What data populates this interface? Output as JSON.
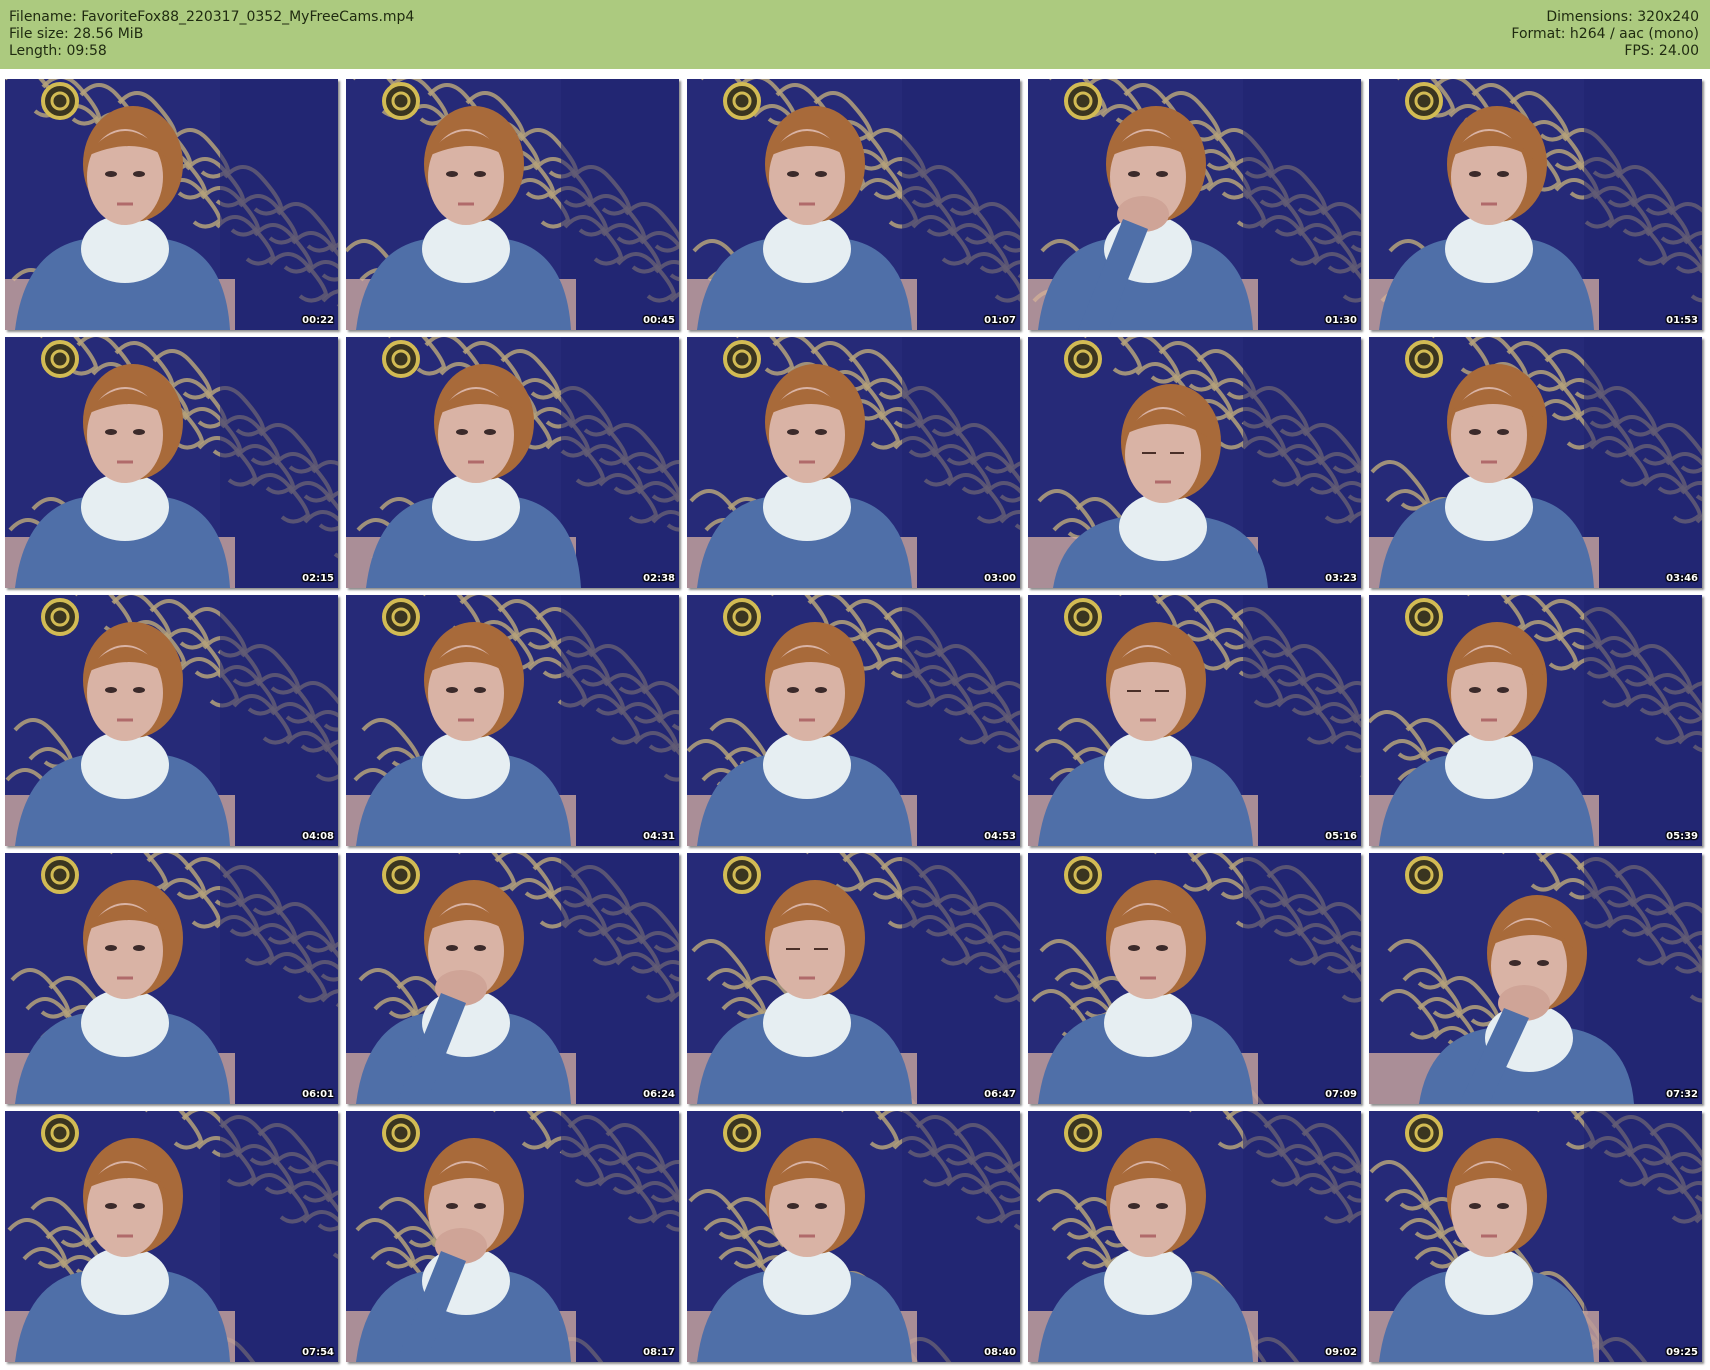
{
  "header": {
    "filename_line": "Filename: FavoriteFox88_220317_0352_MyFreeCams.mp4",
    "filesize_line": "File size: 28.56 MiB",
    "length_line": "Length: 09:58",
    "dimensions_line": "Dimensions: 320x240",
    "format_line": "Format: h264 / aac (mono)",
    "fps_line": "FPS: 24.00"
  },
  "colors": {
    "header_bg": "#acca7f",
    "wallpaper_blue": "#262a78",
    "wallpaper_gold": "#b5a27a",
    "sweater_blue": "#4f6fa8",
    "scarf_white": "#e6eef2",
    "hair": "#a86a3a",
    "skin": "#d9b3a5"
  },
  "thumbnails": [
    {
      "timestamp": "00:22",
      "pose": "neutral"
    },
    {
      "timestamp": "00:45",
      "pose": "neutral"
    },
    {
      "timestamp": "01:07",
      "pose": "neutral"
    },
    {
      "timestamp": "01:30",
      "pose": "hand-on-face"
    },
    {
      "timestamp": "01:53",
      "pose": "neutral"
    },
    {
      "timestamp": "02:15",
      "pose": "neutral"
    },
    {
      "timestamp": "02:38",
      "pose": "tilted"
    },
    {
      "timestamp": "03:00",
      "pose": "neutral"
    },
    {
      "timestamp": "03:23",
      "pose": "looking-down"
    },
    {
      "timestamp": "03:46",
      "pose": "neutral"
    },
    {
      "timestamp": "04:08",
      "pose": "neutral"
    },
    {
      "timestamp": "04:31",
      "pose": "neutral"
    },
    {
      "timestamp": "04:53",
      "pose": "neutral"
    },
    {
      "timestamp": "05:16",
      "pose": "eyes-closed"
    },
    {
      "timestamp": "05:39",
      "pose": "neutral"
    },
    {
      "timestamp": "06:01",
      "pose": "neutral"
    },
    {
      "timestamp": "06:24",
      "pose": "hand-on-face"
    },
    {
      "timestamp": "06:47",
      "pose": "eyes-closed"
    },
    {
      "timestamp": "07:09",
      "pose": "neutral"
    },
    {
      "timestamp": "07:32",
      "pose": "leaning"
    },
    {
      "timestamp": "07:54",
      "pose": "neutral"
    },
    {
      "timestamp": "08:17",
      "pose": "hand-on-face"
    },
    {
      "timestamp": "08:40",
      "pose": "neutral"
    },
    {
      "timestamp": "09:02",
      "pose": "neutral"
    },
    {
      "timestamp": "09:25",
      "pose": "neutral"
    }
  ]
}
